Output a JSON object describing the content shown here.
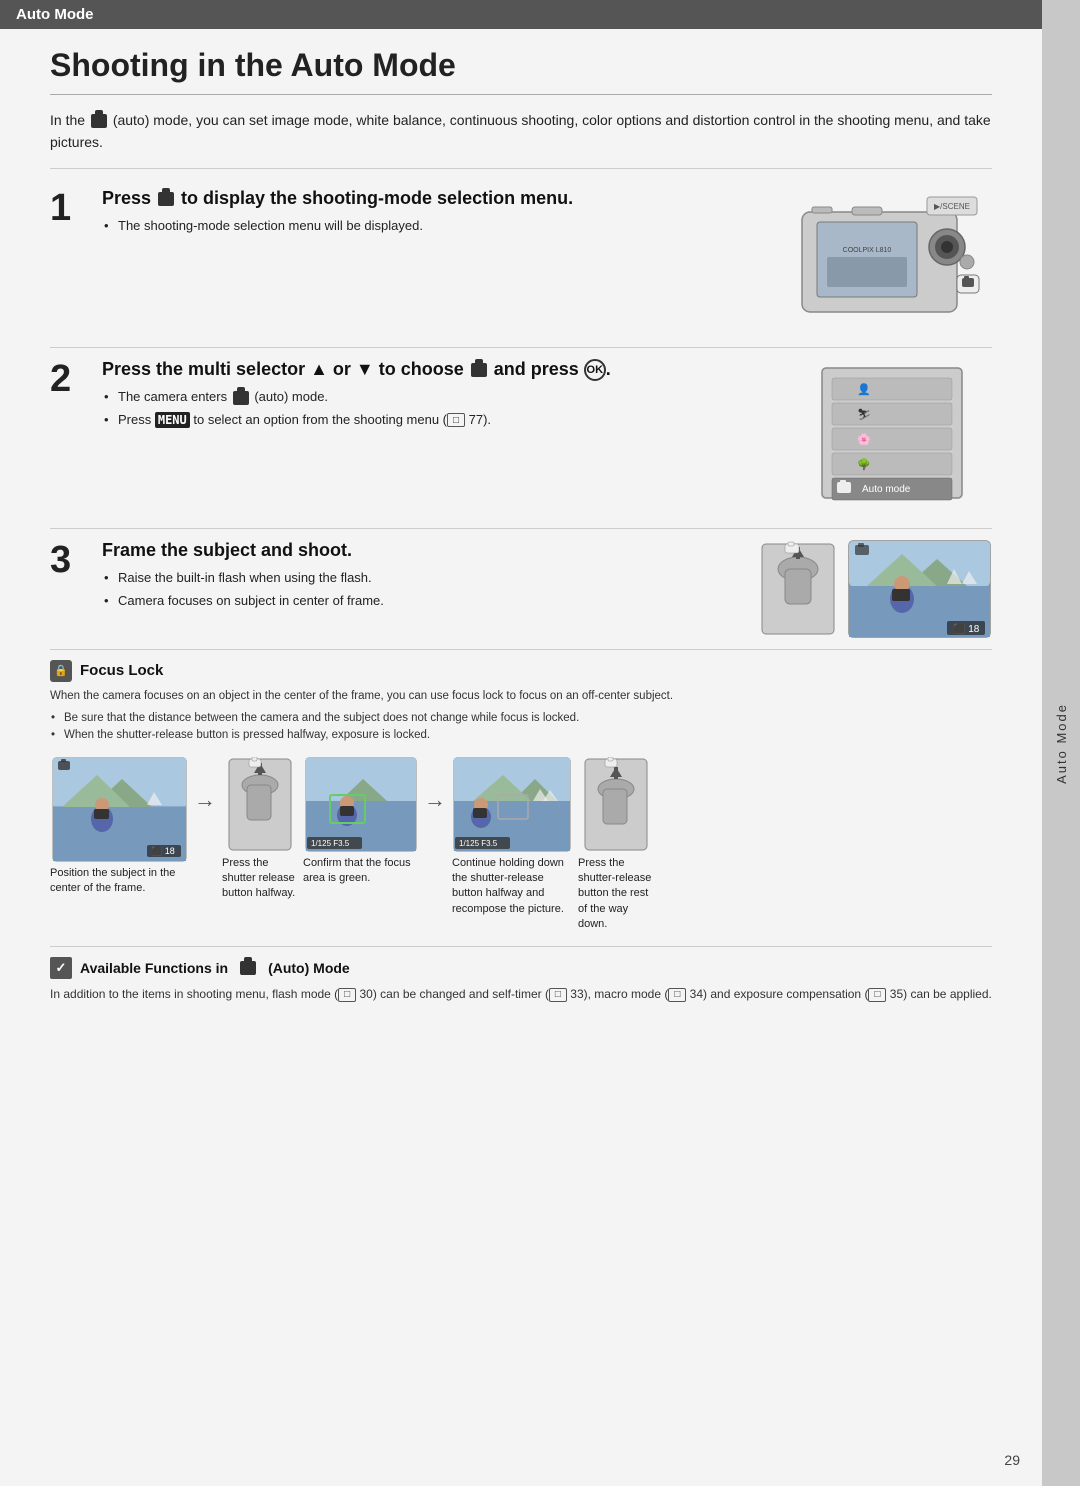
{
  "header": {
    "section_label": "Auto Mode",
    "page_title": "Shooting in the Auto Mode"
  },
  "intro": {
    "text": "(auto) mode, you can set image mode, white balance, continuous shooting, color options and distortion control in the shooting menu, and take pictures."
  },
  "steps": [
    {
      "number": "1",
      "title": "Press  to display the shooting-mode selection menu.",
      "bullets": [
        "The shooting-mode selection menu will be displayed."
      ]
    },
    {
      "number": "2",
      "title": "Press the multi selector ▲ or ▼ to choose  and press ®.",
      "bullets": [
        "The camera enters  (auto) mode.",
        "Press MENU to select an option from the shooting menu (  77)."
      ]
    },
    {
      "number": "3",
      "title": "Frame the subject and shoot.",
      "bullets": [
        "Raise the built-in flash when using the flash.",
        "Camera focuses on subject in center of frame."
      ]
    }
  ],
  "focus_lock": {
    "title": "Focus Lock",
    "description": "When the camera focuses on an object in the center of the frame, you can use focus lock to focus on an off-center subject.",
    "bullets": [
      "Be sure that the distance between the camera and the subject does not change while focus is locked.",
      "When the shutter-release button is pressed halfway, exposure is locked."
    ],
    "images": [
      {
        "caption": "Position the subject in the center of the frame."
      },
      {
        "caption": "Press the shutter release button halfway."
      },
      {
        "caption": "Confirm that the focus area is green."
      },
      {
        "caption": "Continue holding down the shutter-release button halfway and recompose the picture."
      },
      {
        "caption": "Press the shutter-release button the rest of the way down."
      }
    ]
  },
  "available_functions": {
    "title": "Available Functions in  (Auto) Mode",
    "text": "In addition to the items in shooting menu, flash mode (  30) can be changed and self-timer (  33), macro mode (  34) and exposure compensation (  35) can be applied."
  },
  "side_tab": {
    "label": "Auto Mode"
  },
  "page_number": "29"
}
